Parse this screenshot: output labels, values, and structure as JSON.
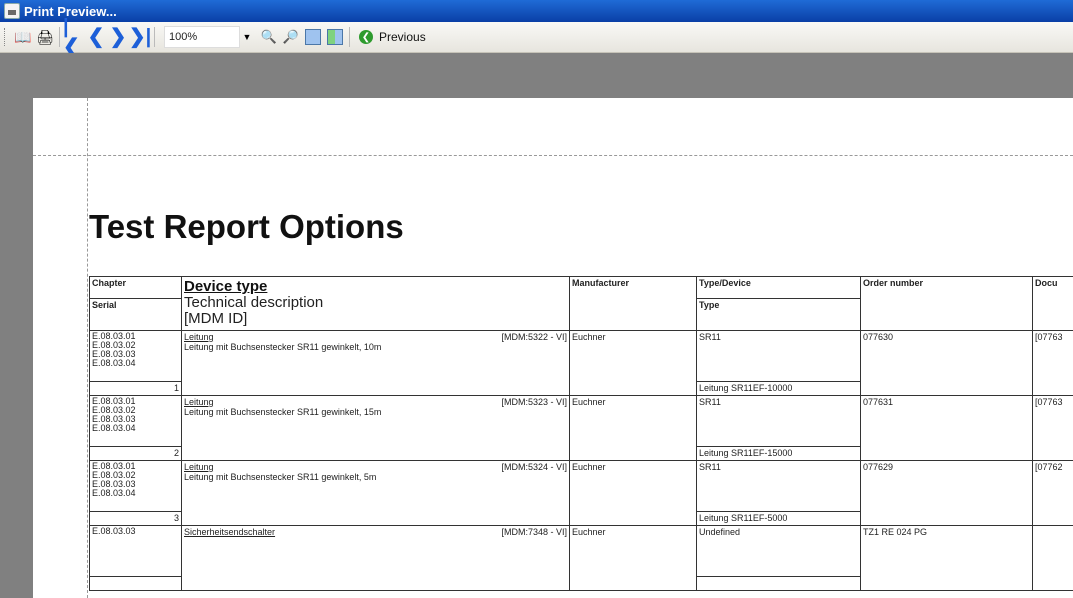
{
  "window": {
    "title": "Print Preview..."
  },
  "toolbar": {
    "zoom": "100%",
    "previous_label": "Previous"
  },
  "report": {
    "title": "Test Report Options",
    "headers": {
      "chapter": "Chapter",
      "serial": "Serial",
      "device_type": "Device type",
      "technical_description": "Technical description",
      "mdm_id": "[MDM ID]",
      "manufacturer": "Manufacturer",
      "type_device": "Type/Device",
      "type": "Type",
      "order_number": "Order number",
      "document": "Docu"
    },
    "rows": [
      {
        "chapters": [
          "E.08.03.01",
          "E.08.03.02",
          "E.08.03.03",
          "E.08.03.04"
        ],
        "serial": "1",
        "device": "Leitung",
        "mdm": "[MDM:5322 - VI]",
        "desc": "Leitung mit Buchsenstecker SR11 gewinkelt, 10m",
        "manufacturer": "Euchner",
        "type_device": "SR11",
        "type": "Leitung SR11EF-10000",
        "order": "077630",
        "doc": "[07763"
      },
      {
        "chapters": [
          "E.08.03.01",
          "E.08.03.02",
          "E.08.03.03",
          "E.08.03.04"
        ],
        "serial": "2",
        "device": "Leitung",
        "mdm": "[MDM:5323 - VI]",
        "desc": "Leitung mit Buchsenstecker SR11 gewinkelt, 15m",
        "manufacturer": "Euchner",
        "type_device": "SR11",
        "type": "Leitung SR11EF-15000",
        "order": "077631",
        "doc": "[07763"
      },
      {
        "chapters": [
          "E.08.03.01",
          "E.08.03.02",
          "E.08.03.03",
          "E.08.03.04"
        ],
        "serial": "3",
        "device": "Leitung",
        "mdm": "[MDM:5324 - VI]",
        "desc": "Leitung mit Buchsenstecker SR11 gewinkelt, 5m",
        "manufacturer": "Euchner",
        "type_device": "SR11",
        "type": "Leitung SR11EF-5000",
        "order": "077629",
        "doc": "[07762"
      },
      {
        "chapters": [
          "E.08.03.03"
        ],
        "serial": "",
        "device": "Sicherheitsendschalter",
        "mdm": "[MDM:7348 - VI]",
        "desc": "",
        "manufacturer": "Euchner",
        "type_device": "Undefined",
        "type": "",
        "order": "TZ1 RE 024 PG",
        "doc": ""
      }
    ]
  }
}
